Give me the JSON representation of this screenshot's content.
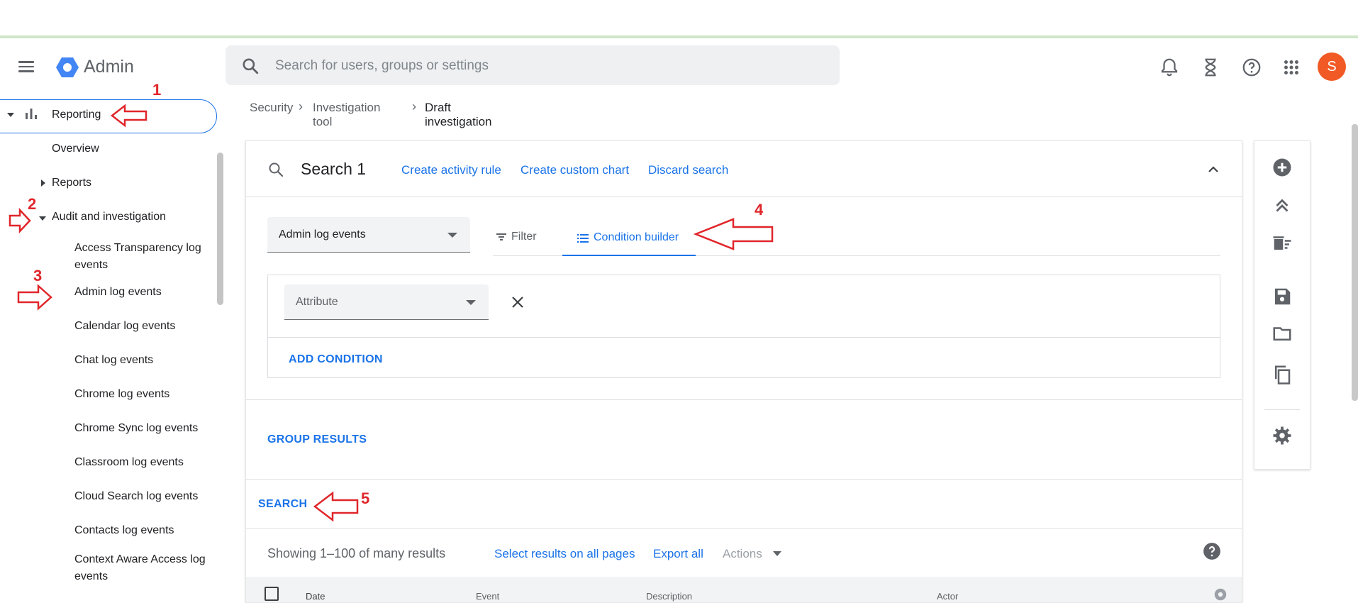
{
  "app": {
    "brand": "Admin"
  },
  "search": {
    "placeholder": "Search for users, groups or settings"
  },
  "user": {
    "avatar_letter": "S"
  },
  "sidebar": {
    "reporting": "Reporting",
    "overview": "Overview",
    "reports": "Reports",
    "audit": "Audit and investigation",
    "items": [
      "Access Transparency log events",
      "Admin log events",
      "Calendar log events",
      "Chat log events",
      "Chrome log events",
      "Chrome Sync log events",
      "Classroom log events",
      "Cloud Search log events",
      "Contacts log events",
      "Context Aware Access log events"
    ]
  },
  "breadcrumb": {
    "items": [
      "Security",
      "Investigation tool",
      "Draft investigation"
    ]
  },
  "search_card": {
    "title": "Search 1",
    "links": [
      "Create activity rule",
      "Create custom chart",
      "Discard search"
    ],
    "data_source": "Admin log events",
    "tabs": {
      "filter": "Filter",
      "condition_builder": "Condition builder"
    },
    "attribute_placeholder": "Attribute",
    "add_condition": "ADD CONDITION",
    "group_results": "GROUP RESULTS",
    "search_button": "SEARCH"
  },
  "results": {
    "summary": "Showing 1–100 of many results",
    "select_all": "Select results on all pages",
    "export_all": "Export all",
    "actions": "Actions",
    "columns": [
      "Date",
      "Event",
      "Description",
      "Actor"
    ]
  },
  "annotations": [
    "1",
    "2",
    "3",
    "4",
    "5"
  ],
  "colors": {
    "accent": "#1a73e8",
    "annotation": "#e0262a",
    "avatar": "#f15a24"
  }
}
